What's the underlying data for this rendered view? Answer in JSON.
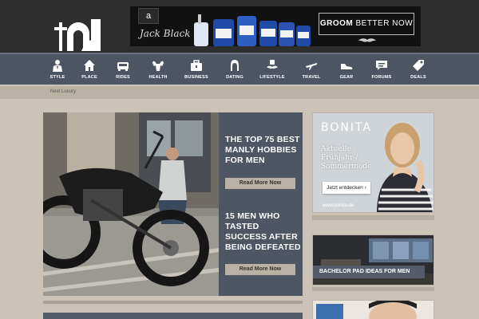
{
  "ad_top": {
    "logo_glyph": "a",
    "brand": "Jack Black",
    "cta_bold": "GROOM",
    "cta_rest": " BETTER NOW"
  },
  "nav": [
    {
      "label": "STYLE",
      "icon": "style-icon"
    },
    {
      "label": "PLACE",
      "icon": "house-icon"
    },
    {
      "label": "RIDES",
      "icon": "car-icon"
    },
    {
      "label": "HEALTH",
      "icon": "muscle-icon"
    },
    {
      "label": "BUSINESS",
      "icon": "briefcase-icon"
    },
    {
      "label": "DATING",
      "icon": "woman-icon"
    },
    {
      "label": "LIFESTYLE",
      "icon": "mustache-icon"
    },
    {
      "label": "TRAVEL",
      "icon": "plane-icon"
    },
    {
      "label": "GEAR",
      "icon": "shoe-icon"
    },
    {
      "label": "FORUMS",
      "icon": "chat-icon"
    },
    {
      "label": "DEALS",
      "icon": "tag-icon"
    }
  ],
  "breadcrumb": "Next Luxury",
  "featured": {
    "stories": [
      {
        "title": "THE TOP 75 BEST MANLY HOBBIES FOR MEN",
        "cta": "Read More Now"
      },
      {
        "title": "15 MEN WHO TASTED SUCCESS AFTER BEING DEFEATED",
        "cta": "Read More Now"
      }
    ]
  },
  "right_ad": {
    "logo": "BONITA",
    "text_line1": "Aktuelle",
    "text_line2": "Frühjahr-/",
    "text_line3": "Sommermode",
    "button": "Jetzt entdecken ›",
    "url": "www.bonita.de"
  },
  "right_card": {
    "title": "BACHELOR PAD IDEAS FOR MEN"
  },
  "colors": {
    "nav_bg": "#4d5563",
    "header_bg": "#2e2e2e",
    "page_bg": "#cbc3b7",
    "accent_button": "#b9b1a3"
  }
}
